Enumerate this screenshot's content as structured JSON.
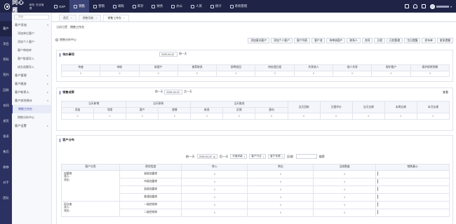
{
  "topbar": {
    "logo": "同心雁",
    "logo_sub": "销售·在线管理",
    "nav": [
      {
        "label": "GSP",
        "icon": "gsp-icon"
      },
      {
        "label": "销售",
        "icon": "sales-icon",
        "active": true
      },
      {
        "label": "营销",
        "icon": "marketing-icon"
      },
      {
        "label": "采购",
        "icon": "purchase-icon"
      },
      {
        "label": "库存",
        "icon": "stock-icon"
      },
      {
        "label": "财务",
        "icon": "finance-icon"
      },
      {
        "label": "办公",
        "icon": "office-icon"
      },
      {
        "label": "人资",
        "icon": "hr-icon"
      },
      {
        "label": "统计",
        "icon": "stats-icon"
      },
      {
        "label": "系统管理",
        "icon": "system-icon"
      }
    ]
  },
  "rail": [
    "客户",
    "项目",
    "招标",
    "签约",
    "回款",
    "合同",
    "退货",
    "投诉",
    "售后",
    "维修",
    "对手",
    "团队"
  ],
  "menu": {
    "search_placeholder": "搜索",
    "items": [
      {
        "label": "客户添加",
        "type": "group"
      },
      {
        "label": "添加单位客户",
        "type": "sub"
      },
      {
        "label": "添加个人客户",
        "type": "sub"
      },
      {
        "label": "客户审核库",
        "type": "sub"
      },
      {
        "label": "客户批量导入",
        "type": "sub"
      },
      {
        "label": "成交选题导入",
        "type": "sub"
      },
      {
        "label": "客户管理",
        "type": "group"
      },
      {
        "label": "客户跟进",
        "type": "group"
      },
      {
        "label": "客户联系人",
        "type": "group"
      },
      {
        "label": "客户综合统计",
        "type": "group"
      },
      {
        "label": "销售工作台",
        "type": "sub",
        "active": true
      },
      {
        "label": "销售分析中心",
        "type": "sub"
      },
      {
        "label": "客户设置",
        "type": "group"
      }
    ]
  },
  "tabs": [
    {
      "label": "首页"
    },
    {
      "label": "销售导航"
    },
    {
      "label": "销售工作台",
      "active": true
    }
  ],
  "breadcrumb": {
    "parent": "当前位置",
    "current": "销售工作台"
  },
  "radio_label": "销售分析中心",
  "buttons": [
    "添加意向客户",
    "添加个人客户",
    "客户列表",
    "客户池",
    "待审核客户",
    "联系人",
    "合同",
    "日程",
    "日程管理",
    "生日提醒",
    "发布单",
    "更多提醒"
  ],
  "todo": {
    "title": "待办事项",
    "date": "2025-04-22",
    "range": "周一天",
    "headers": [
      "待查",
      "待收",
      "新客户",
      "推荐联系",
      "即将收回",
      "待处理日程",
      "共享他人",
      "他人共享",
      "保护客户",
      "保护即将到期"
    ],
    "values": [
      "0",
      "0",
      "0",
      "0",
      "0",
      "0",
      "0",
      "0",
      "0",
      "0"
    ]
  },
  "perf": {
    "title": "销售成果",
    "prev": "前一天",
    "date": "2025-04-22",
    "next": "后一天",
    "right": "查看",
    "group_headers": [
      "当天新增",
      "当天联系",
      "当天推进"
    ],
    "sub_headers": [
      "添加",
      "领用",
      "客户",
      "递增",
      "新息",
      "反馈",
      "意向"
    ],
    "tail_headers": [
      "当天回款",
      "日报评价",
      "当天业绩",
      "本周业绩",
      "本月业绩"
    ],
    "values": [
      "0",
      "0",
      "0",
      "0",
      "0",
      "0",
      "0",
      "0",
      "0",
      "0",
      "0",
      "0"
    ]
  },
  "dist": {
    "title": "客户分布",
    "prev": "前一天",
    "date": "2025-04-22",
    "next": "后一天",
    "filters": [
      "价值评级",
      "客户行业",
      "客户来源"
    ],
    "area_label": "区域:",
    "search_btn": "搜索",
    "headers": [
      "客户分类",
      "原状程度",
      "转入",
      "转出",
      "当前数量",
      "销售漏斗"
    ],
    "groups": [
      {
        "name": "加盟商",
        "lines": [
          "流入:",
          "流出:"
        ],
        "rows": [
          "省级加盟商",
          "市级加盟商",
          "县级加盟商",
          "普通加盟商"
        ]
      },
      {
        "name": "同业者",
        "lines": [
          "流入:",
          "流出:"
        ],
        "rows": [
          "一级经销商",
          "二级经销商"
        ]
      }
    ],
    "zero": "0"
  }
}
